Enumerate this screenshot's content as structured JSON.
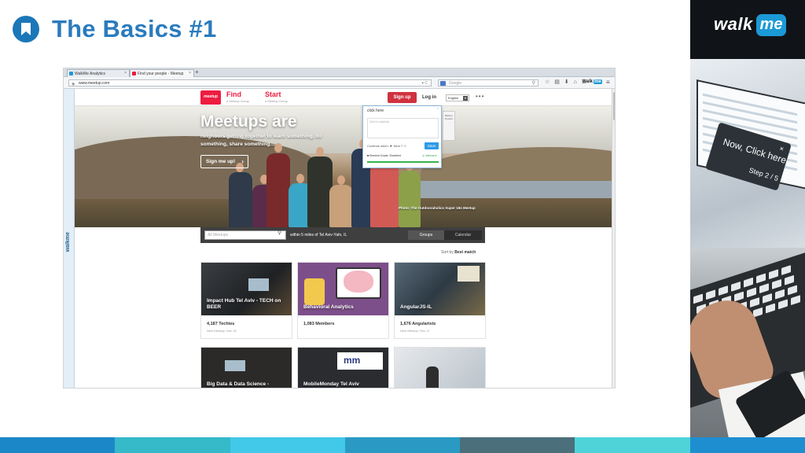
{
  "slide": {
    "title": "The Basics #1",
    "brand": {
      "walk": "walk",
      "me": "me"
    },
    "tooltip": {
      "text": "Now, Click here",
      "step": "Step 2 / 5",
      "close": "×"
    },
    "colors": {
      "accent": "#2a7bbd",
      "brand_blue": "#1c9ad6",
      "meetup_red": "#ed1c40"
    },
    "bottom_bar_colors": [
      "#1b87c9",
      "#36b9c9",
      "#42c8e8",
      "#2a9ac5",
      "#4b6f7b",
      "#4fd3d8",
      "#1f8ed1"
    ]
  },
  "browser": {
    "tabs": [
      {
        "label": "WalkMe Analytics",
        "icon": "walkme-favicon-icon"
      },
      {
        "label": "Find your people - Meetup",
        "icon": "meetup-favicon-icon"
      }
    ],
    "tab_close": "×",
    "new_tab": "+",
    "url": "www.meetup.com",
    "search_placeholder": "Google",
    "walkme_logo": {
      "walk": "walk",
      "me": "me"
    }
  },
  "meetup": {
    "logo": "meetup",
    "nav": [
      {
        "label": "Find",
        "sub": "a Meetup Group"
      },
      {
        "label": "Start",
        "sub": "a Meetup Group"
      }
    ],
    "signup_btn": "Sign up",
    "login": "Log in",
    "language": "English",
    "more": "•••",
    "hero": {
      "title": "Meetups are",
      "subtitle": "neighbors getting together to learn something, do something, share something…",
      "signup": "Sign me up!",
      "credit": "Photo: The Outdooraholics Super 18s Meetup"
    },
    "search": {
      "placeholder": "All Meetups",
      "within": "within  5 miles  of  Tel Aviv-Yafo, IL",
      "groups": "Groups",
      "calendar": "Calendar"
    },
    "sort": {
      "label": "Sort by",
      "value": "Best match"
    },
    "cards": [
      {
        "title": "Impact Hub Tel Aviv - TECH on BEER",
        "count": "4,187 Techies",
        "next": "Next Meetup: Dec 15"
      },
      {
        "title": "Behavioral Analytics",
        "count": "1,083 Members",
        "next": ""
      },
      {
        "title": "AngularJS-IL",
        "count": "1,676 Angularists",
        "next": "Next Meetup: Dec 17"
      }
    ],
    "cards_row2": [
      {
        "title": "Big Data & Data Science -"
      },
      {
        "title": "MobileMonday Tel Aviv"
      },
      {
        "title": ""
      }
    ]
  },
  "walkme_editor": {
    "title": "click here",
    "close": "×",
    "area_placeholder": "Click to add/edit",
    "tools": "Continue when:  ☛  Next  T  ☺",
    "save": "Save",
    "footer": "■ Element Grade: Excellent",
    "status": "◎ Interval ▾",
    "balloon": "Balloon Position"
  },
  "walkme_side_tab": "walkme"
}
